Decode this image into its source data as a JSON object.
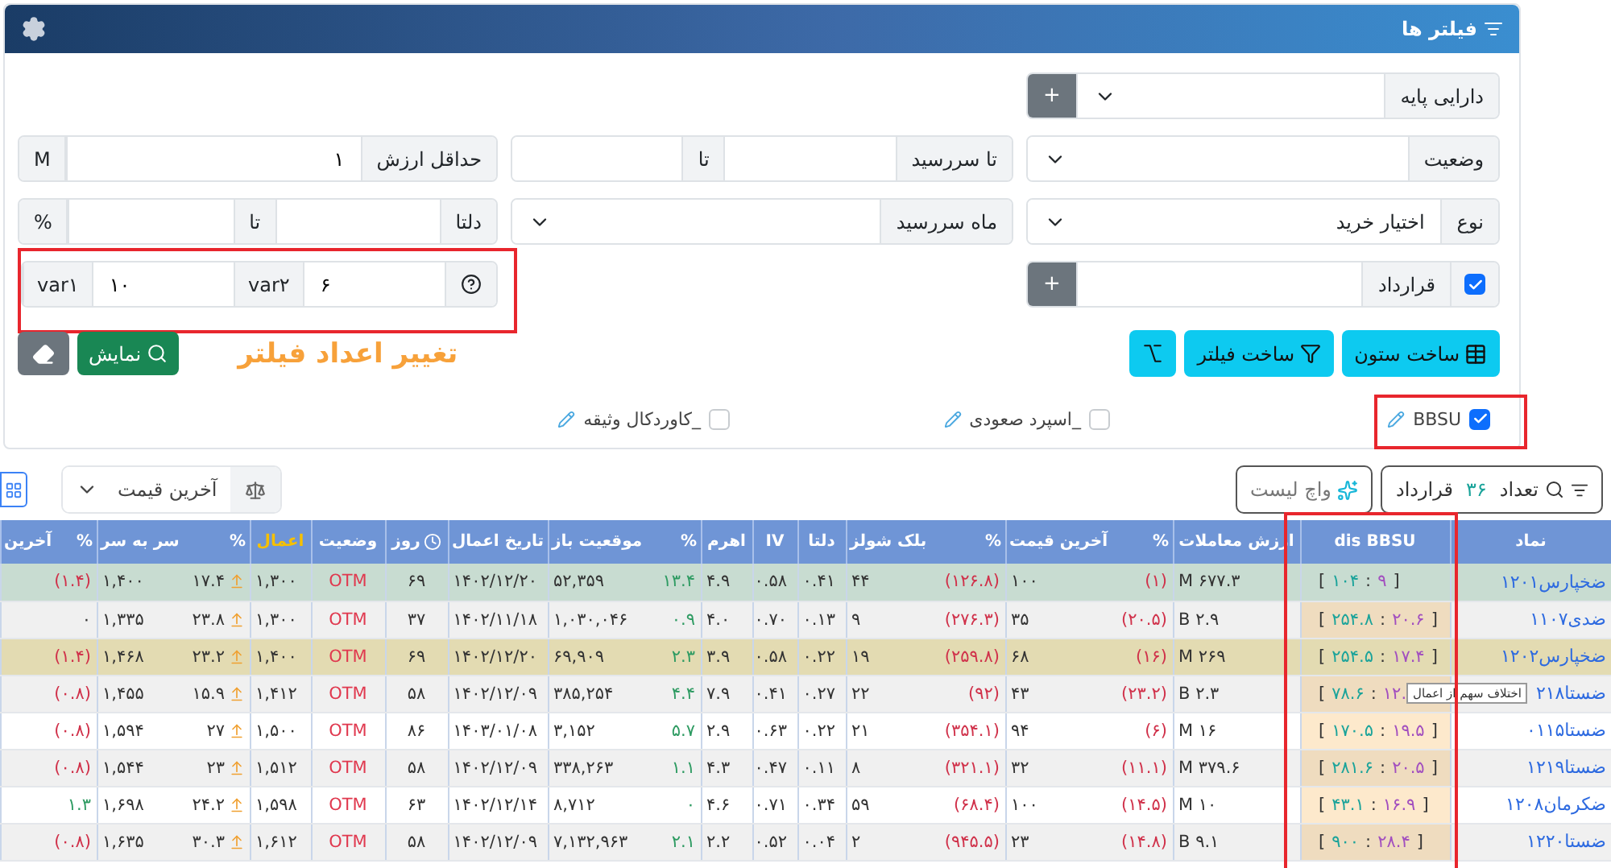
{
  "panel": {
    "title": "فیلتر ها"
  },
  "filters": {
    "underlying": {
      "label": "دارایی پایه",
      "add": "+"
    },
    "status": {
      "label": "وضعیت"
    },
    "expiry_to": {
      "label": "تا سررسید",
      "to": "تا"
    },
    "min_value": {
      "label": "حداقل ارزش",
      "value": "۱",
      "unit": "M"
    },
    "type": {
      "label": "نوع",
      "value": "اختیار خرید"
    },
    "expiry_month": {
      "label": "ماه سررسید"
    },
    "delta": {
      "label": "دلتا",
      "to": "تا",
      "unit": "%"
    },
    "contract": {
      "checked": true,
      "label": "قرارداد",
      "add": "+"
    },
    "vars": [
      {
        "label": "var۲",
        "value": "۶"
      },
      {
        "label": "var۱",
        "value": "۱۰"
      }
    ]
  },
  "actions": {
    "build_column": "ساخت ستون",
    "build_filter": "ساخت فیلتر",
    "show": "نمایش",
    "note": "تغییر اعداد فیلتر"
  },
  "strategies": [
    {
      "label": "BBSU",
      "checked": true
    },
    {
      "label": "_اسپرد صعودی",
      "checked": false
    },
    {
      "label": "_کاوردکال وثیقه",
      "checked": false
    }
  ],
  "toolbar": {
    "count_label": "تعداد",
    "count": "۳۶",
    "count_unit": "قرارداد",
    "watchlist": "واچ لیست",
    "sort": "آخرین قیمت"
  },
  "table": {
    "columns": [
      {
        "kind": "symbol",
        "label": "نماد"
      },
      {
        "kind": "dis",
        "label": "dis BBSU"
      },
      {
        "kind": "value",
        "label": "ارزش معاملات"
      },
      {
        "kind": "value",
        "label": "آخرین قیمت",
        "pct": "%",
        "color": "#d0314a"
      },
      {
        "kind": "value",
        "label": "بلک شولز",
        "pct": "%",
        "color": "#d0314a"
      },
      {
        "kind": "value",
        "label": "دلتا"
      },
      {
        "kind": "value",
        "label": "IV"
      },
      {
        "kind": "value",
        "label": "اهرم"
      },
      {
        "kind": "value",
        "label": "موقعیت باز",
        "pct": "%",
        "color": "#2e9b62"
      },
      {
        "kind": "value",
        "label": "تاریخ اعمال"
      },
      {
        "kind": "days",
        "label": "روز"
      },
      {
        "kind": "status",
        "label": "وضعیت"
      },
      {
        "kind": "value",
        "label": "اعمال",
        "highlighted": true
      },
      {
        "kind": "rise",
        "label": "سر به سر",
        "pct": "%"
      },
      {
        "kind": "value",
        "label": "آخرین",
        "pct": "%"
      }
    ],
    "rows": [
      {
        "color": "#c8dcd1",
        "cells": [
          {
            "value": "ضخپارس۱۲۰۱"
          },
          {
            "parts": [
              "[",
              "۱۰۴",
              ":",
              "۹",
              "]"
            ]
          },
          {
            "value": "۶۷۷.۳ M"
          },
          {
            "value": "۱۰۰",
            "pct": "(۱)"
          },
          {
            "value": "۴۴",
            "pct": "(۱۲۶.۸)"
          },
          {
            "value": "۰.۴۱"
          },
          {
            "value": "۰.۵۸"
          },
          {
            "value": "۴.۹"
          },
          {
            "value": "۵۲,۳۵۹",
            "pct": "۱۳.۴"
          },
          {
            "value": "۱۴۰۲/۱۲/۲۰"
          },
          {
            "value": "۶۹"
          },
          {
            "value": "OTM"
          },
          {
            "value": "۱,۳۰۰"
          },
          {
            "value": "۱,۴۰۰",
            "pct": "۱۷.۴"
          },
          {
            "pct": "(۱.۴)",
            "color": "#d0314a"
          }
        ]
      },
      {
        "cells": [
          {
            "value": "ضدی۱۱۰۷"
          },
          {
            "parts": [
              "[",
              "۲۵۴.۸",
              ":",
              "۲۰.۶",
              "]"
            ]
          },
          {
            "value": "۲.۹ B"
          },
          {
            "value": "۳۵",
            "pct": "(۲۰.۵)"
          },
          {
            "value": "۹",
            "pct": "(۲۷۶.۳)"
          },
          {
            "value": "۰.۱۳"
          },
          {
            "value": "۰.۷۰"
          },
          {
            "value": "۴.۰"
          },
          {
            "value": "۱,۰۳۰,۰۴۶",
            "pct": "۰.۹"
          },
          {
            "value": "۱۴۰۲/۱۱/۱۸"
          },
          {
            "value": "۳۷"
          },
          {
            "value": "OTM"
          },
          {
            "value": "۱,۳۰۰"
          },
          {
            "value": "۱,۳۳۵",
            "pct": "۲۳.۸"
          },
          {
            "pct": "۰"
          }
        ]
      },
      {
        "color": "#e3dbb2",
        "cells": [
          {
            "value": "ضخپارس۱۲۰۲"
          },
          {
            "parts": [
              "[",
              "۲۵۴.۵",
              ":",
              "۱۷.۴",
              "]"
            ]
          },
          {
            "value": "۲۶۹ M"
          },
          {
            "value": "۶۸",
            "pct": "(۱۶)"
          },
          {
            "value": "۱۹",
            "pct": "(۲۵۹.۸)"
          },
          {
            "value": "۰.۲۲"
          },
          {
            "value": "۰.۵۸"
          },
          {
            "value": "۳.۹"
          },
          {
            "value": "۶۹,۹۰۹",
            "pct": "۲.۳"
          },
          {
            "value": "۱۴۰۲/۱۲/۲۰"
          },
          {
            "value": "۶۹"
          },
          {
            "value": "OTM"
          },
          {
            "value": "۱,۴۰۰"
          },
          {
            "value": "۱,۴۶۸",
            "pct": "۲۳.۲"
          },
          {
            "pct": "(۱.۴)",
            "color": "#d0314a"
          }
        ]
      },
      {
        "cells": [
          {
            "value": "ضستا۲۱۸"
          },
          {
            "parts": [
              "[",
              "۷۸.۶",
              ":",
              "۱۲."
            ]
          },
          {
            "value": "۲.۳ B"
          },
          {
            "value": "۴۳",
            "pct": "(۲۳.۲)"
          },
          {
            "value": "۲۲",
            "pct": "(۹۲)"
          },
          {
            "value": "۰.۲۷"
          },
          {
            "value": "۰.۴۱"
          },
          {
            "value": "۷.۹"
          },
          {
            "value": "۳۸۵,۲۵۴",
            "pct": "۴.۴"
          },
          {
            "value": "۱۴۰۲/۱۲/۰۹"
          },
          {
            "value": "۵۸"
          },
          {
            "value": "OTM"
          },
          {
            "value": "۱,۴۱۲"
          },
          {
            "value": "۱,۴۵۵",
            "pct": "۱۵.۹"
          },
          {
            "pct": "(۰.۸)",
            "color": "#d0314a"
          }
        ]
      },
      {
        "cells": [
          {
            "value": "ضستا۰۱۱۵"
          },
          {
            "parts": [
              "[",
              "۱۷۰.۵",
              ":",
              "۱۹.۵",
              "]"
            ]
          },
          {
            "value": "۱۶ M"
          },
          {
            "value": "۹۴",
            "pct": "(۶)"
          },
          {
            "value": "۲۱",
            "pct": "(۳۵۴.۱)"
          },
          {
            "value": "۰.۲۲"
          },
          {
            "value": "۰.۶۳"
          },
          {
            "value": "۲.۹"
          },
          {
            "value": "۳,۱۵۲",
            "pct": "۵.۷"
          },
          {
            "value": "۱۴۰۳/۰۱/۰۸"
          },
          {
            "value": "۸۶"
          },
          {
            "value": "OTM"
          },
          {
            "value": "۱,۵۰۰"
          },
          {
            "value": "۱,۵۹۴",
            "pct": "۲۷"
          },
          {
            "pct": "(۰.۸)",
            "color": "#d0314a"
          }
        ]
      },
      {
        "cells": [
          {
            "value": "ضستا۱۲۱۹"
          },
          {
            "parts": [
              "[",
              "۲۸۱.۶",
              ":",
              "۲۰.۵",
              "]"
            ]
          },
          {
            "value": "۳۷۹.۶ M"
          },
          {
            "value": "۳۲",
            "pct": "(۱۱.۱)"
          },
          {
            "value": "۸",
            "pct": "(۳۲۱.۱)"
          },
          {
            "value": "۰.۱۱"
          },
          {
            "value": "۰.۴۷"
          },
          {
            "value": "۴.۳"
          },
          {
            "value": "۳۳۸,۲۶۳",
            "pct": "۱.۱"
          },
          {
            "value": "۱۴۰۲/۱۲/۰۹"
          },
          {
            "value": "۵۸"
          },
          {
            "value": "OTM"
          },
          {
            "value": "۱,۵۱۲"
          },
          {
            "value": "۱,۵۴۴",
            "pct": "۲۳"
          },
          {
            "pct": "(۰.۸)",
            "color": "#d0314a"
          }
        ]
      },
      {
        "cells": [
          {
            "value": "ضکرمان۱۲۰۸"
          },
          {
            "parts": [
              "[",
              "۴۳.۱",
              ":",
              "۱۶.۹",
              "]"
            ]
          },
          {
            "value": "۱۰ M"
          },
          {
            "value": "۱۰۰",
            "pct": "(۱۴.۵)"
          },
          {
            "value": "۵۹",
            "pct": "(۶۸.۴)"
          },
          {
            "value": "۰.۳۴"
          },
          {
            "value": "۰.۷۱"
          },
          {
            "value": "۴.۶"
          },
          {
            "value": "۸,۷۱۲",
            "pct": "۰"
          },
          {
            "value": "۱۴۰۲/۱۲/۱۴"
          },
          {
            "value": "۶۳"
          },
          {
            "value": "OTM"
          },
          {
            "value": "۱,۵۹۸"
          },
          {
            "value": "۱,۶۹۸",
            "pct": "۲۴.۲"
          },
          {
            "pct": "۱.۳",
            "color": "#2e9b62"
          }
        ]
      },
      {
        "cells": [
          {
            "value": "ضستا۱۲۲۰"
          },
          {
            "parts": [
              "[",
              "۹۰۰",
              ":",
              "۲۸.۴",
              "]"
            ]
          },
          {
            "value": "۹.۱ B"
          },
          {
            "value": "۲۳",
            "pct": "(۱۴.۸)"
          },
          {
            "value": "۲",
            "pct": "(۹۴۵.۵)"
          },
          {
            "value": "۰.۰۴"
          },
          {
            "value": "۰.۵۲"
          },
          {
            "value": "۲.۲"
          },
          {
            "value": "۷,۱۳۲,۹۶۳",
            "pct": "۲.۱"
          },
          {
            "value": "۱۴۰۲/۱۲/۰۹"
          },
          {
            "value": "۵۸"
          },
          {
            "value": "OTM"
          },
          {
            "value": "۱,۶۱۲"
          },
          {
            "value": "۱,۶۳۵",
            "pct": "۳۰.۳"
          },
          {
            "pct": "(۰.۸)",
            "color": "#d0314a"
          }
        ]
      }
    ]
  },
  "tooltip": "اختلاف سهم از اعمال"
}
